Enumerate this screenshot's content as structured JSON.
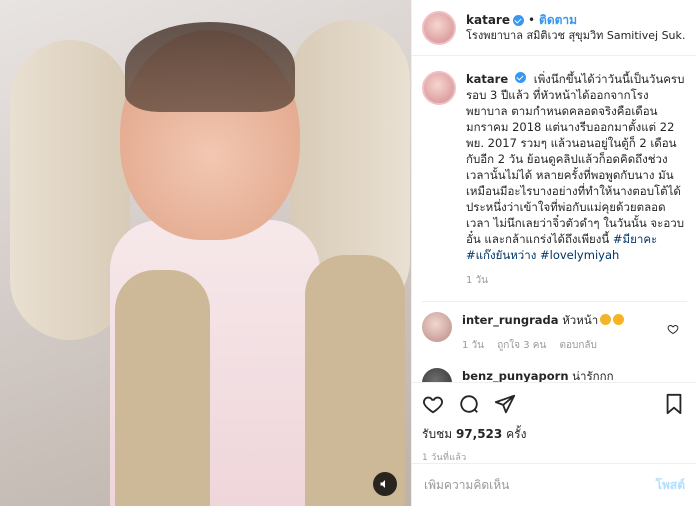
{
  "post": {
    "username": "katare",
    "follow_label": "ติดตาม",
    "location": "โรงพยาบาล สมิติเวช สุขุมวิท Samitivej Sukhum..."
  },
  "caption": {
    "username": "katare",
    "text": "เพิ่งนึกขึ้นได้ว่าวันนี้เป็นวันครบรอบ 3 ปีแล้ว ที่หัวหน้าได้ออกจากโรงพยาบาล ตามกำหนดคลอดจริงคือเดือนมกราคม 2018 แต่นางรีบออกมาตั้งแต่ 22 พย. 2017 รวมๆ แล้วนอนอยู่ในตู้ก็ 2 เดือนกับอีก 2 วัน ย้อนดูคลิปแล้วก็อดคิดถึงช่วงเวลานั้นไม่ได้ หลายครั้งที่พอพูดกับนาง มันเหมือนมีอะไรบางอย่างที่ทำให้นางตอบโต้ได้ ประหนึ่งว่าเข้าใจที่พ่อกับแม่คุยด้วยตลอดเวลา ไม่นึกเลยว่าจิ๋วตัวดำๆ ในวันนั้น จะอวบอั๋น และกล้าแกร่งได้ถึงเพียงนี้",
    "hashtags": "#มียาคะ #แก๊งยันหว่าง #lovelymiyah",
    "time": "1 วัน"
  },
  "comments": [
    {
      "username": "inter_rungrada",
      "text": "หัวหน้า",
      "time": "1 วัน",
      "likes": "ถูกใจ 3 คน",
      "reply_label": "ตอบกลับ"
    },
    {
      "username": "benz_punyaporn",
      "text": "น่ารักกก"
    }
  ],
  "stats": {
    "views_label": "รับชม",
    "views_count": "97,523",
    "views_suffix": "ครั้ง",
    "time_ago": "1 วันที่แล้ว"
  },
  "add_comment": {
    "placeholder": "เพิ่มความคิดเห็น",
    "post_label": "โพสต์"
  }
}
